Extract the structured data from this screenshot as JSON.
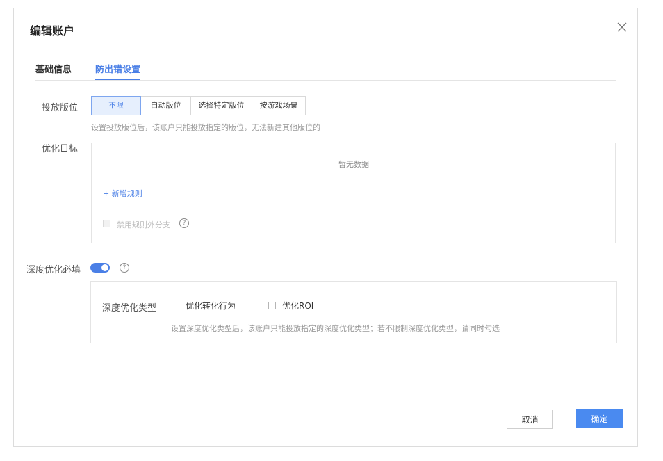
{
  "dialog": {
    "title": "编辑账户",
    "close_icon": "close-icon"
  },
  "tabs": [
    {
      "label": "基础信息"
    },
    {
      "label": "防出错设置"
    }
  ],
  "placement": {
    "label": "投放版位",
    "options": [
      "不限",
      "自动版位",
      "选择特定版位",
      "按游戏场景"
    ],
    "selected": "不限",
    "hint": "设置投放版位后，该账户只能投放指定的版位，无法新建其他版位的"
  },
  "optimization": {
    "label": "优化目标",
    "empty_text": "暂无数据",
    "add_rule": "+ 新增规则",
    "disable_branch_label": "禁用规则外分支",
    "help_icon": "?"
  },
  "deep": {
    "label": "深度优化必填",
    "toggle_on": true,
    "help_icon": "?",
    "type_label": "深度优化类型",
    "options": [
      "优化转化行为",
      "优化ROI"
    ],
    "hint": "设置深度优化类型后，该账户只能投放指定的深度优化类型；若不限制深度优化类型，请同时勾选"
  },
  "footer": {
    "cancel": "取消",
    "ok": "确定"
  },
  "colors": {
    "accent": "#4a7fe6",
    "primary_button": "#4a8af0"
  }
}
